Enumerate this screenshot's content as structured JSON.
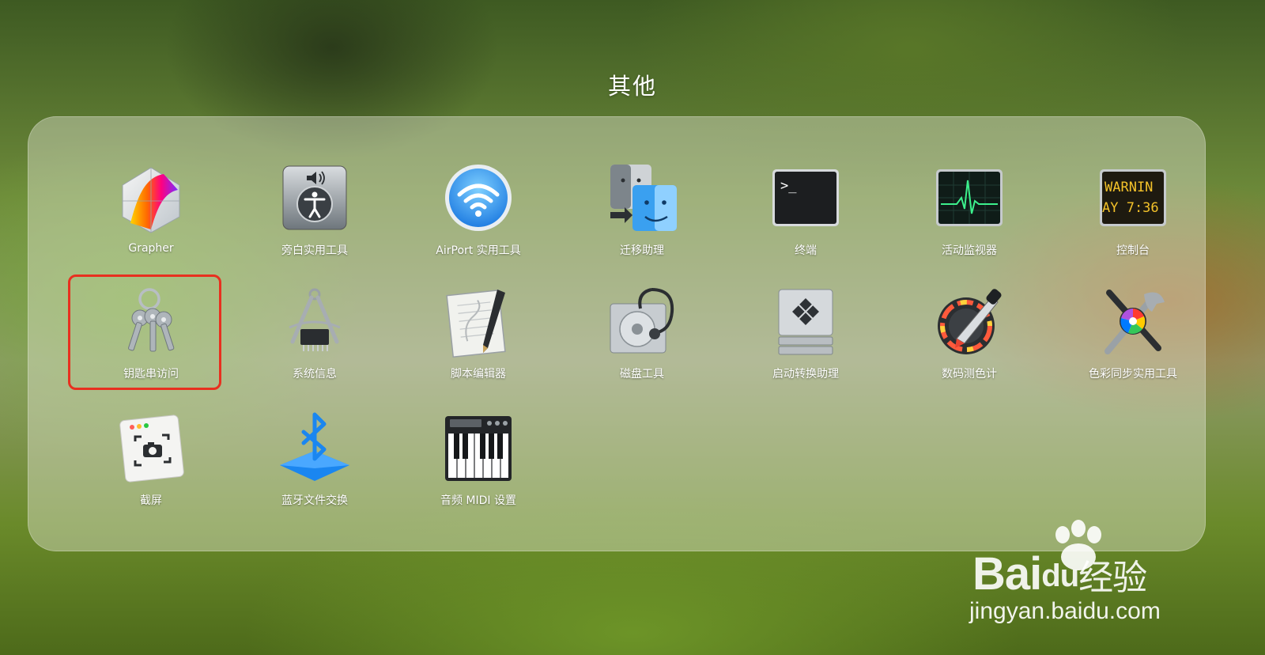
{
  "folder": {
    "title": "其他"
  },
  "apps": [
    {
      "label": "Grapher",
      "icon": "grapher-icon"
    },
    {
      "label": "旁白实用工具",
      "icon": "voiceover-utility-icon"
    },
    {
      "label": "AirPort 实用工具",
      "icon": "airport-utility-icon"
    },
    {
      "label": "迁移助理",
      "icon": "migration-assistant-icon"
    },
    {
      "label": "终端",
      "icon": "terminal-icon"
    },
    {
      "label": "活动监视器",
      "icon": "activity-monitor-icon"
    },
    {
      "label": "控制台",
      "icon": "console-icon"
    },
    {
      "label": "钥匙串访问",
      "icon": "keychain-access-icon"
    },
    {
      "label": "系统信息",
      "icon": "system-information-icon"
    },
    {
      "label": "脚本编辑器",
      "icon": "script-editor-icon"
    },
    {
      "label": "磁盘工具",
      "icon": "disk-utility-icon"
    },
    {
      "label": "启动转换助理",
      "icon": "boot-camp-assistant-icon"
    },
    {
      "label": "数码测色计",
      "icon": "digital-color-meter-icon"
    },
    {
      "label": "色彩同步实用工具",
      "icon": "colorsync-utility-icon"
    },
    {
      "label": "截屏",
      "icon": "screenshot-icon"
    },
    {
      "label": "蓝牙文件交换",
      "icon": "bluetooth-file-exchange-icon"
    },
    {
      "label": "音频 MIDI 设置",
      "icon": "audio-midi-setup-icon"
    }
  ],
  "console_icon_text": {
    "line1": "WARNIN",
    "line2": "AY 7:36"
  },
  "terminal_icon_text": ">_",
  "highlight_color": "#e8301f",
  "watermark": {
    "logo_text": "Bai",
    "logo_text2": "du",
    "logo_suffix": "经验",
    "url": "jingyan.baidu.com"
  }
}
